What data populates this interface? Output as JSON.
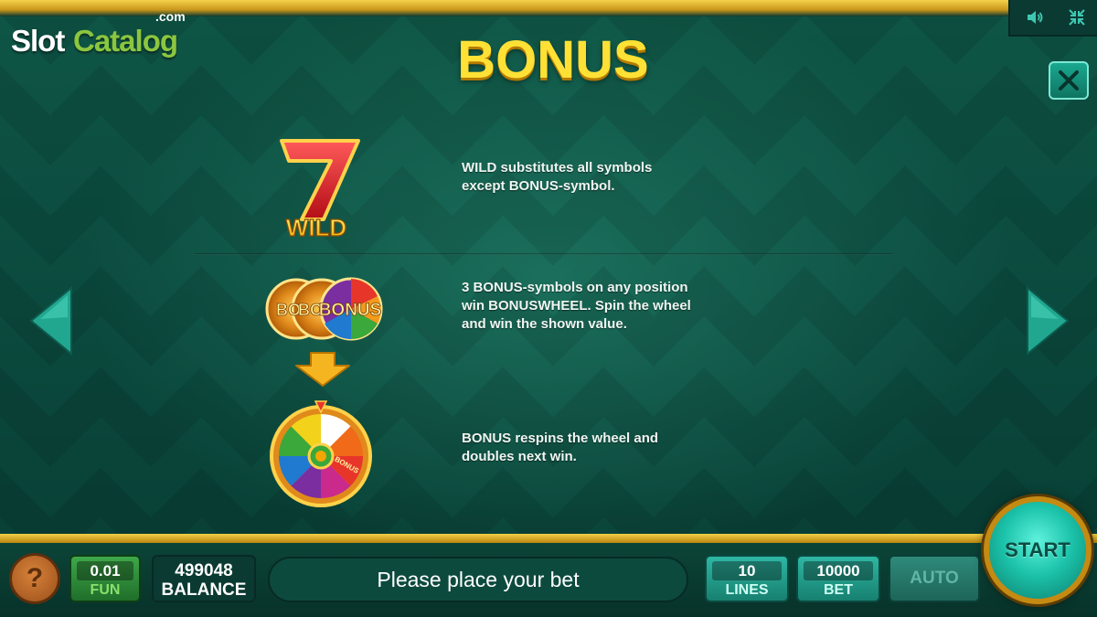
{
  "logo": {
    "slot": "Slot",
    "catalog": "Catalog",
    "com": ".com"
  },
  "header": {
    "title": "BONUS"
  },
  "icons": {
    "sound": "speaker-icon",
    "fullscreen": "collapse-arrows-icon",
    "close": "close-icon",
    "prev": "left-triangle-icon",
    "next": "right-triangle-icon"
  },
  "rules": [
    {
      "symbol": "seven-wild-symbol",
      "symbol_text": "WILD",
      "symbol_digit": "7",
      "lines": [
        "WILD substitutes all symbols",
        "except BONUS-symbol."
      ]
    },
    {
      "symbol": "bonus-coins-symbol",
      "symbol_text": "BONUS",
      "partial_text_1": "BO",
      "partial_text_2": "BO",
      "lines": [
        "3 BONUS-symbols on any position",
        "win BONUSWHEEL. Spin the wheel",
        "and win the shown value."
      ]
    },
    {
      "symbol": "bonus-wheel-symbol",
      "wheel_segment_label": "BONUS",
      "lines": [
        "BONUS respins the wheel  and",
        "doubles next win."
      ]
    }
  ],
  "bottom_bar": {
    "help_label": "?",
    "fun_value": "0.01",
    "fun_label": "FUN",
    "balance_value": "499048",
    "balance_label": "BALANCE",
    "message": "Please place your bet",
    "lines_value": "10",
    "lines_label": "LINES",
    "bet_value": "10000",
    "bet_label": "BET",
    "auto_label": "AUTO",
    "start_label": "START"
  },
  "colors": {
    "background": "#0b4a3e",
    "title": "#ffe135",
    "gold_rail": "#f3cf47",
    "start": "#1cc3aa"
  }
}
